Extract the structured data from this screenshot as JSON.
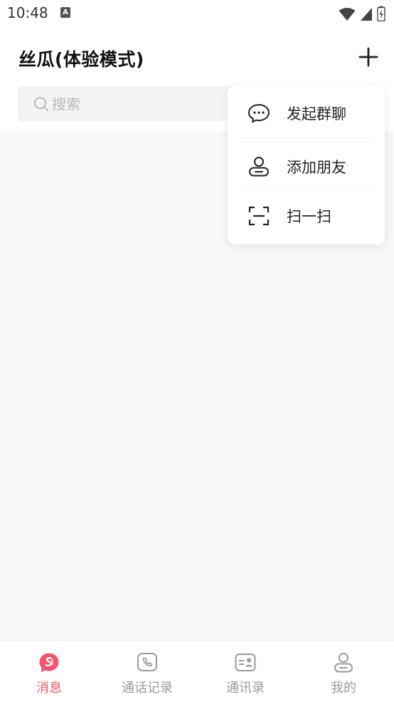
{
  "status_bar": {
    "time": "10:48",
    "notification_glyph": "A"
  },
  "header": {
    "title": "丝瓜(体验模式)",
    "add_icon": "plus-icon"
  },
  "search": {
    "placeholder": "搜索",
    "value": ""
  },
  "popup_menu": {
    "items": [
      {
        "label": "发起群聊",
        "icon": "group-chat-icon"
      },
      {
        "label": "添加朋友",
        "icon": "add-friend-icon"
      },
      {
        "label": "扫一扫",
        "icon": "scan-icon"
      }
    ]
  },
  "tab_bar": {
    "active_color": "#f2566d",
    "tabs": [
      {
        "label": "消息",
        "icon": "message-icon",
        "active": true
      },
      {
        "label": "通话记录",
        "icon": "call-log-icon",
        "active": false
      },
      {
        "label": "通讯录",
        "icon": "contacts-icon",
        "active": false
      },
      {
        "label": "我的",
        "icon": "profile-icon",
        "active": false
      }
    ]
  }
}
